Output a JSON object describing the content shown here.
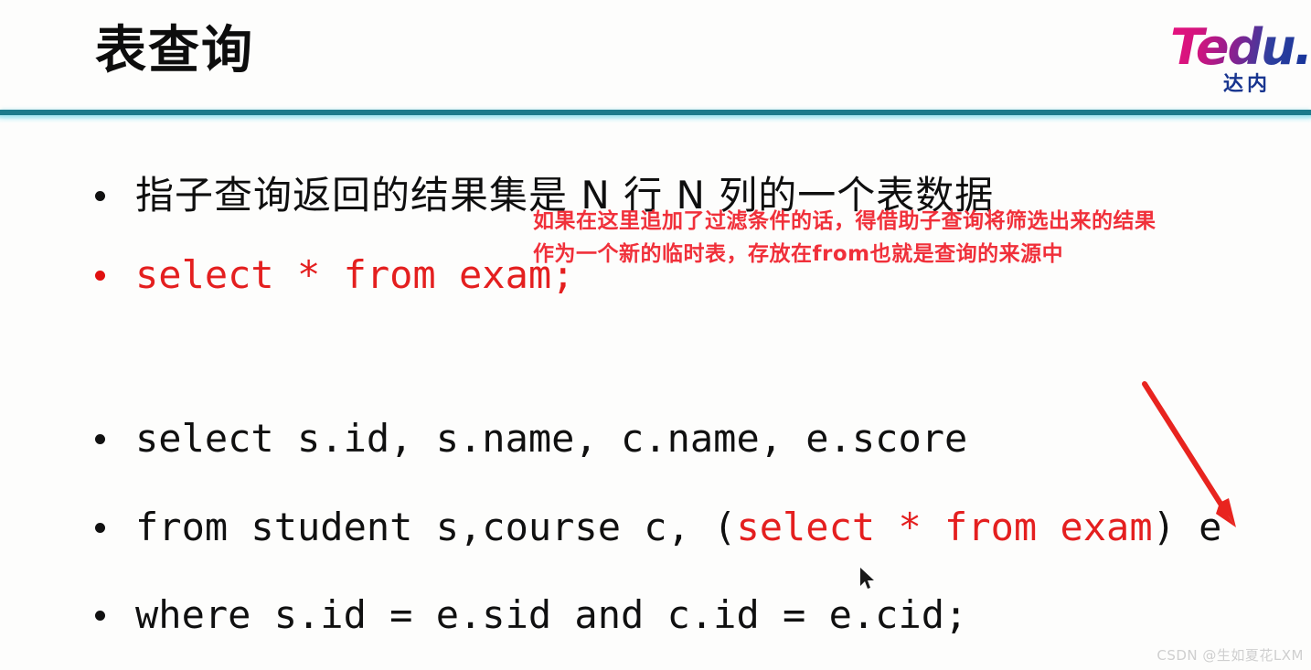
{
  "slide": {
    "title": "表查询",
    "logo": {
      "wordmark": "Tedu.",
      "subtitle": "达内"
    },
    "accent_color": "#1b7b8c",
    "glow_color": "#9fe3ef",
    "code_red": "#e41f1f",
    "annotation_red": "#f0303a"
  },
  "bullets": [
    {
      "id": "subquery-definition",
      "kind": "chinese",
      "bullet_color": "#111111",
      "text": "指子查询返回的结果集是 N 行 N 列的一个表数据"
    },
    {
      "id": "select-exam",
      "kind": "code-red",
      "bullet_color": "#e01010",
      "text": "select * from exam;"
    },
    {
      "id": "select-columns",
      "kind": "code",
      "bullet_color": "#111111",
      "text": "select s.id, s.name, c.name, e.score"
    },
    {
      "id": "from-tables",
      "kind": "code-mixed",
      "bullet_color": "#111111",
      "prefix": "from student s,course c, (",
      "highlight": "select * from exam",
      "suffix": ") e"
    },
    {
      "id": "where-join",
      "kind": "code",
      "bullet_color": "#111111",
      "text": "where s.id = e.sid and c.id = e.cid;"
    }
  ],
  "annotation": {
    "line1": "如果在这里追加了过滤条件的话，得借助子查询将筛选出来的结果",
    "line2": "作为一个新的临时表，存放在from也就是查询的来源中"
  },
  "watermark": {
    "text": "CSDN @生如夏花LXM"
  }
}
